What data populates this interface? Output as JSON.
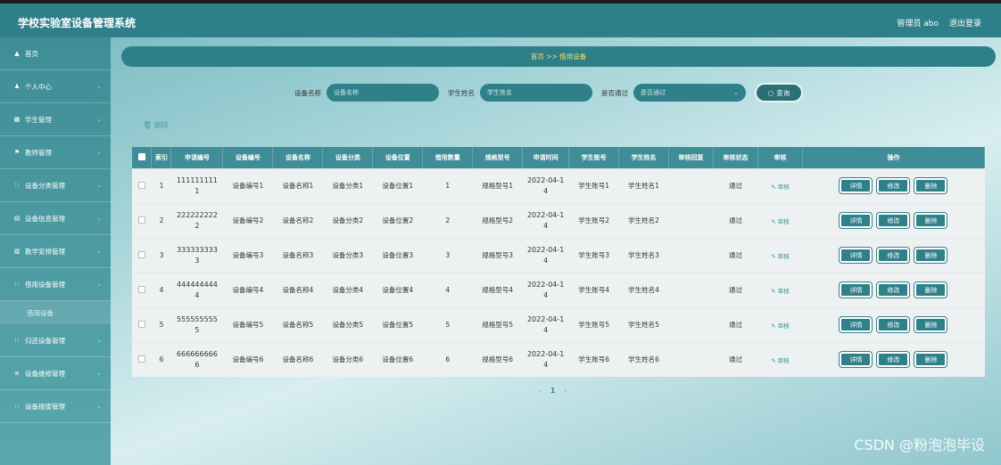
{
  "app": {
    "title": "学校实验室设备管理系统"
  },
  "top": {
    "admin": "管理员 abo",
    "logout": "退出登录"
  },
  "sidebar": {
    "items": [
      {
        "icon": "▲",
        "label": "首页"
      },
      {
        "icon": "♟",
        "label": "个人中心"
      },
      {
        "icon": "▦",
        "label": "学生管理"
      },
      {
        "icon": "⚑",
        "label": "教师管理"
      },
      {
        "icon": "∷",
        "label": "设备分类管理"
      },
      {
        "icon": "▤",
        "label": "设备信息管理"
      },
      {
        "icon": "▥",
        "label": "教学安排管理"
      },
      {
        "icon": "∷",
        "label": "借用设备管理"
      },
      {
        "icon": "∷",
        "label": "归还设备管理"
      },
      {
        "icon": "≡",
        "label": "设备维修管理"
      },
      {
        "icon": "∷",
        "label": "设备报废管理"
      }
    ],
    "sub_item": "借用设备"
  },
  "breadcrumb": "首页 >> 借用设备",
  "search": {
    "device_name_label": "设备名称",
    "device_name_placeholder": "设备名称",
    "student_name_label": "学生姓名",
    "student_name_placeholder": "学生姓名",
    "passed_label": "是否通过",
    "passed_placeholder": "是否通过",
    "query_button": "查询",
    "select_chevron": "⌄"
  },
  "delete_link": "删除",
  "table": {
    "headers": [
      "索引",
      "申请编号",
      "设备编号",
      "设备名称",
      "设备分类",
      "设备位置",
      "借用数量",
      "规格型号",
      "申请时间",
      "学生账号",
      "学生姓名",
      "审核回复",
      "审核状态",
      "审核",
      "操作"
    ],
    "rows": [
      {
        "index": "1",
        "app_no_1": "111111111",
        "app_no_2": "1",
        "device_no": "设备编号1",
        "device_name": "设备名称1",
        "category": "设备分类1",
        "location": "设备位置1",
        "qty": "1",
        "spec": "规格型号1",
        "time_1": "2022-04-1",
        "time_2": "4",
        "account": "学生账号1",
        "student": "学生姓名1",
        "reply": "",
        "status": "通过",
        "audit": "审核"
      },
      {
        "index": "2",
        "app_no_1": "222222222",
        "app_no_2": "2",
        "device_no": "设备编号2",
        "device_name": "设备名称2",
        "category": "设备分类2",
        "location": "设备位置2",
        "qty": "2",
        "spec": "规格型号2",
        "time_1": "2022-04-1",
        "time_2": "4",
        "account": "学生账号2",
        "student": "学生姓名2",
        "reply": "",
        "status": "通过",
        "audit": "审核"
      },
      {
        "index": "3",
        "app_no_1": "333333333",
        "app_no_2": "3",
        "device_no": "设备编号3",
        "device_name": "设备名称3",
        "category": "设备分类3",
        "location": "设备位置3",
        "qty": "3",
        "spec": "规格型号3",
        "time_1": "2022-04-1",
        "time_2": "4",
        "account": "学生账号3",
        "student": "学生姓名3",
        "reply": "",
        "status": "通过",
        "audit": "审核"
      },
      {
        "index": "4",
        "app_no_1": "444444444",
        "app_no_2": "4",
        "device_no": "设备编号4",
        "device_name": "设备名称4",
        "category": "设备分类4",
        "location": "设备位置4",
        "qty": "4",
        "spec": "规格型号4",
        "time_1": "2022-04-1",
        "time_2": "4",
        "account": "学生账号4",
        "student": "学生姓名4",
        "reply": "",
        "status": "通过",
        "audit": "审核"
      },
      {
        "index": "5",
        "app_no_1": "555555555",
        "app_no_2": "5",
        "device_no": "设备编号5",
        "device_name": "设备名称5",
        "category": "设备分类5",
        "location": "设备位置5",
        "qty": "5",
        "spec": "规格型号5",
        "time_1": "2022-04-1",
        "time_2": "4",
        "account": "学生账号5",
        "student": "学生姓名5",
        "reply": "",
        "status": "通过",
        "audit": "审核"
      },
      {
        "index": "6",
        "app_no_1": "666666666",
        "app_no_2": "6",
        "device_no": "设备编号6",
        "device_name": "设备名称6",
        "category": "设备分类6",
        "location": "设备位置6",
        "qty": "6",
        "spec": "规格型号6",
        "time_1": "2022-04-1",
        "time_2": "4",
        "account": "学生账号6",
        "student": "学生姓名6",
        "reply": "",
        "status": "通过",
        "audit": "审核"
      }
    ],
    "actions": {
      "detail": "详情",
      "edit": "修改",
      "delete": "删除"
    }
  },
  "pager": {
    "prev": "‹",
    "current": "1",
    "next": "›"
  },
  "watermark": "CSDN @粉泡泡毕设",
  "colors": {
    "primary": "#2f8089",
    "header": "#3f8e97",
    "breadcrumb_text": "#f3e06a"
  }
}
